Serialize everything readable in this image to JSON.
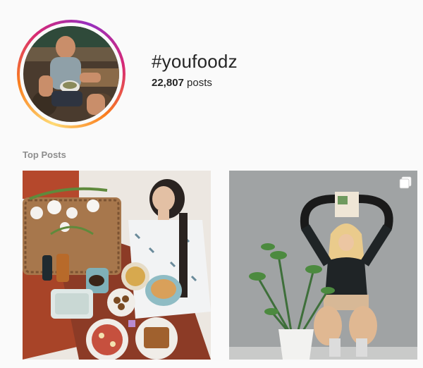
{
  "hashtag": {
    "title": "#youfoodz",
    "post_count": "22,807",
    "post_count_suffix": " posts"
  },
  "sections": {
    "top_posts_label": "Top Posts"
  },
  "posts": [
    {
      "kind": "photo",
      "icon": "none"
    },
    {
      "kind": "photo",
      "icon": "multiple-photos-icon"
    }
  ],
  "colors": {
    "ring_gradient": [
      "#feda75",
      "#fa7e1e",
      "#d62976",
      "#962fbf"
    ],
    "muted_text": "#8e8e8e",
    "background": "#fafafa"
  }
}
